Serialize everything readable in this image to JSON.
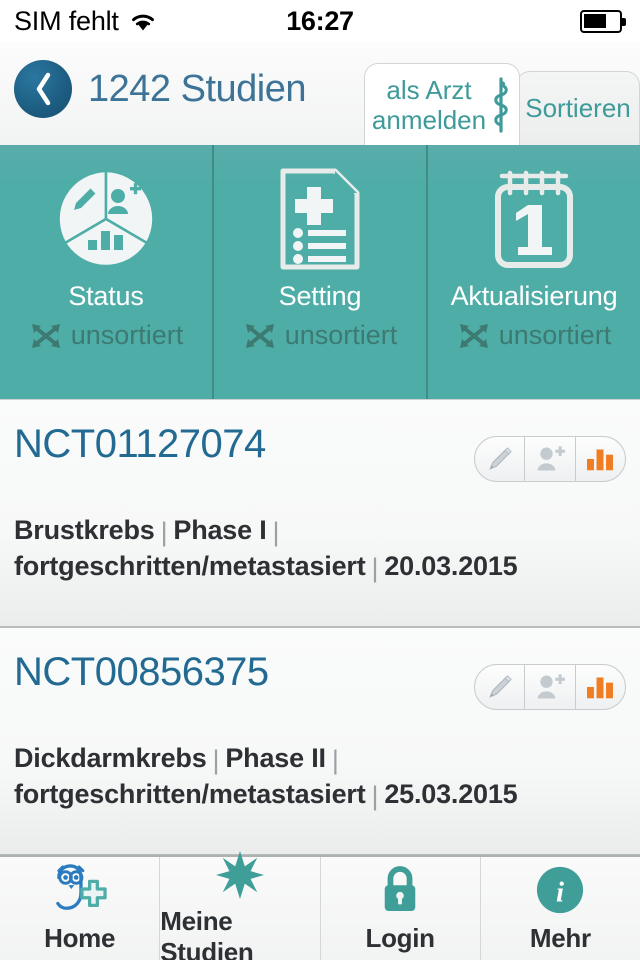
{
  "statusbar": {
    "carrier": "SIM fehlt",
    "wifi_icon": "wifi-icon",
    "time": "16:27",
    "battery_icon": "battery-icon"
  },
  "navbar": {
    "back_icon": "back-chevron-icon",
    "title": "1242 Studien",
    "tabs": [
      {
        "label": "als Arzt\nanmelden",
        "icon": "asclepius-staff-icon",
        "active": true
      },
      {
        "label": "Sortieren",
        "icon": "",
        "active": false
      }
    ]
  },
  "sort_panel": {
    "cells": [
      {
        "title": "Status",
        "state": "unsortiert",
        "icon": "status-pie-icon",
        "state_icon": "shuffle-arrows-icon"
      },
      {
        "title": "Setting",
        "state": "unsortiert",
        "icon": "medical-document-icon",
        "state_icon": "shuffle-arrows-icon"
      },
      {
        "title": "Aktualisierung",
        "state": "unsortiert",
        "icon": "calendar-one-icon",
        "state_icon": "shuffle-arrows-icon"
      }
    ]
  },
  "studies": [
    {
      "id": "NCT01127074",
      "indication": "Brustkrebs",
      "phase": "Phase I",
      "stage": "fortgeschritten/metastasiert",
      "date": "20.03.2015",
      "badge": [
        "pencil-icon",
        "person-add-icon",
        "bar-chart-icon"
      ]
    },
    {
      "id": "NCT00856375",
      "indication": "Dickdarmkrebs",
      "phase": "Phase II",
      "stage": "fortgeschritten/metastasiert",
      "date": "25.03.2015",
      "badge": [
        "pencil-icon",
        "person-add-icon",
        "bar-chart-icon"
      ]
    }
  ],
  "tabbar": {
    "items": [
      {
        "label": "Home",
        "icon": "owl-cross-logo-icon"
      },
      {
        "label": "Meine Studien",
        "icon": "star-burst-icon"
      },
      {
        "label": "Login",
        "icon": "padlock-icon"
      },
      {
        "label": "Mehr",
        "icon": "info-circle-icon"
      }
    ]
  },
  "colors": {
    "teal": "#4fada8",
    "teal_dark": "#3f8c8a",
    "accent_blue": "#236a93",
    "nav_title_blue": "#3d7396",
    "orange": "#f07d22",
    "text_dark": "#2d3134",
    "page_bg": "#f7f8f8"
  }
}
